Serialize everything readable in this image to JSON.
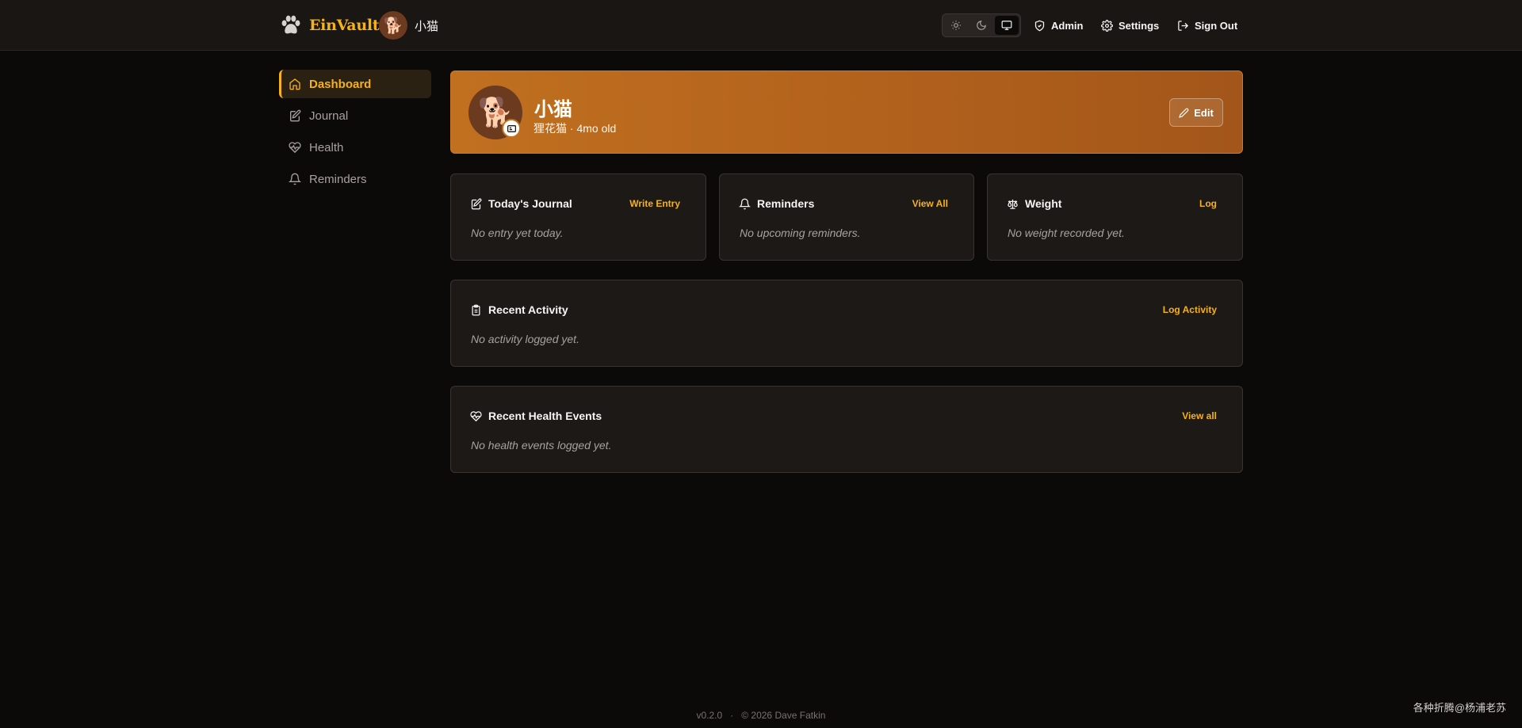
{
  "app": {
    "brand_name": "EinVault",
    "pet_name": "小猫",
    "pet_emoji": "🐕"
  },
  "header": {
    "theme_options": [
      {
        "name": "light",
        "icon": "sun-icon",
        "active": false
      },
      {
        "name": "dark",
        "icon": "moon-icon",
        "active": false
      },
      {
        "name": "system",
        "icon": "monitor-icon",
        "active": true
      }
    ],
    "admin_label": "Admin",
    "settings_label": "Settings",
    "signout_label": "Sign Out"
  },
  "sidebar": {
    "items": [
      {
        "label": "Dashboard",
        "icon": "home-icon",
        "active": true
      },
      {
        "label": "Journal",
        "icon": "journal-icon",
        "active": false
      },
      {
        "label": "Health",
        "icon": "heart-pulse-icon",
        "active": false
      },
      {
        "label": "Reminders",
        "icon": "bell-icon",
        "active": false
      }
    ]
  },
  "hero": {
    "name": "小猫",
    "subtitle": "狸花猫 · 4mo old",
    "avatar_emoji": "🐕",
    "edit_label": "Edit"
  },
  "cards": {
    "journal": {
      "title": "Today's Journal",
      "link": "Write Entry",
      "empty": "No entry yet today."
    },
    "reminders": {
      "title": "Reminders",
      "link": "View All",
      "empty": "No upcoming reminders."
    },
    "weight": {
      "title": "Weight",
      "link": "Log",
      "empty": "No weight recorded yet."
    },
    "activity": {
      "title": "Recent Activity",
      "link": "Log Activity",
      "empty": "No activity logged yet."
    },
    "health": {
      "title": "Recent Health Events",
      "link": "View all",
      "empty": "No health events logged yet."
    }
  },
  "footer": {
    "version": "v0.2.0",
    "separator": "·",
    "copyright": "© 2026 Dave Fatkin"
  },
  "watermark": "各种折腾@杨浦老苏",
  "colors": {
    "accent": "#f5b21a",
    "background": "#0c0a09",
    "card": "#1c1917",
    "hero_orange": "#b5641d"
  }
}
